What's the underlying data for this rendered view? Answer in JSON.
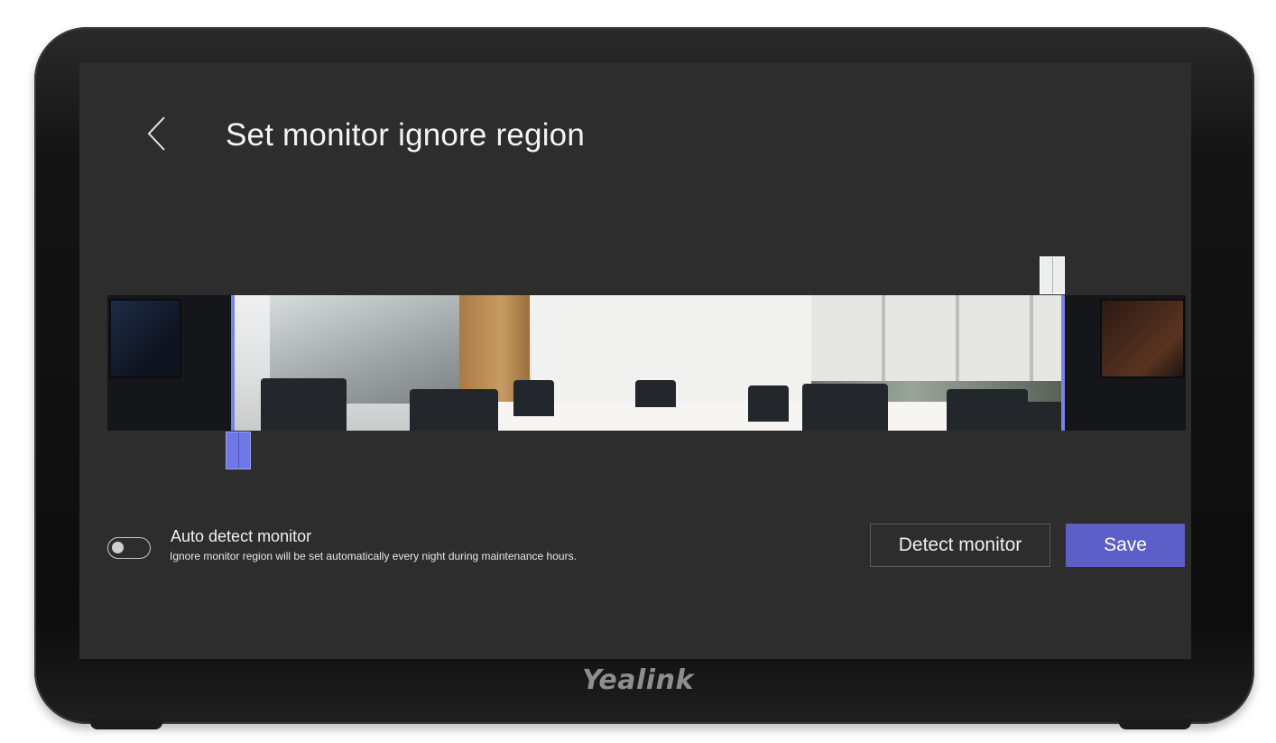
{
  "header": {
    "title": "Set monitor ignore region",
    "back_icon": "chevron-left-icon"
  },
  "auto_detect": {
    "label": "Auto detect monitor",
    "description": "Ignore monitor region will be set automatically every night during maintenance hours.",
    "enabled": false
  },
  "actions": {
    "detect_label": "Detect monitor",
    "save_label": "Save"
  },
  "device": {
    "brand": "Yealink"
  },
  "colors": {
    "accent": "#5b5fc7",
    "selection": "#7b83eb",
    "screen_bg": "#2d2d2d"
  }
}
